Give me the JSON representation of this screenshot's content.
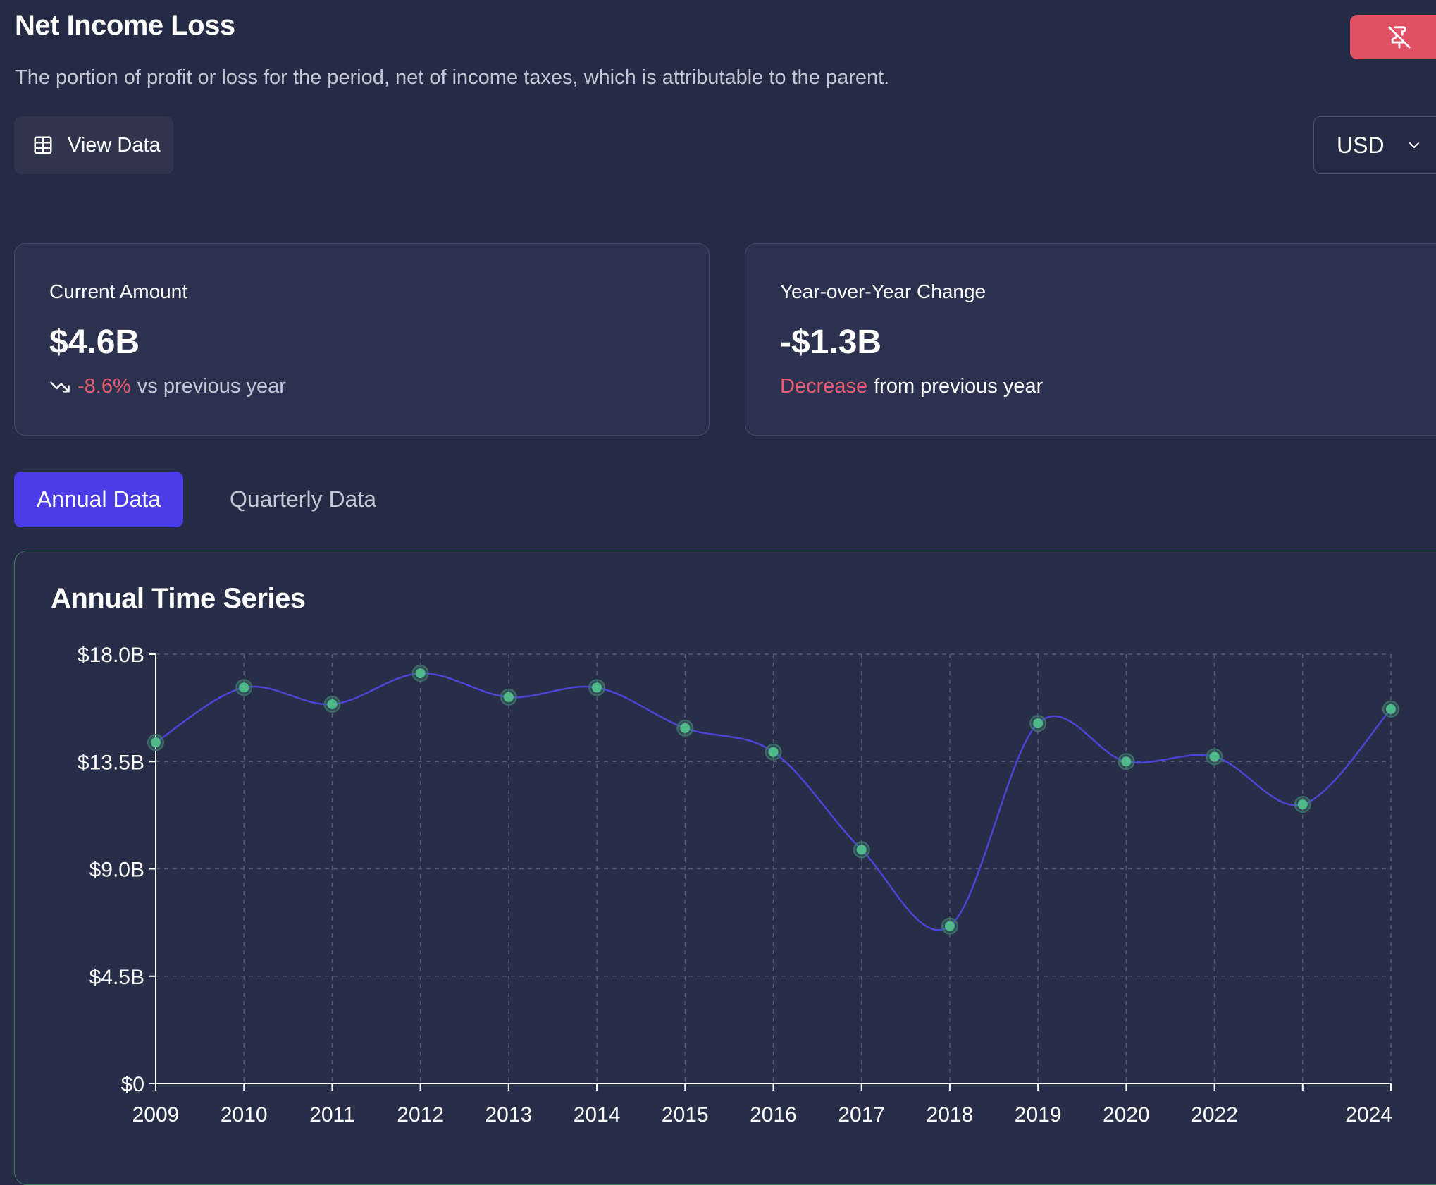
{
  "header": {
    "title": "Net Income Loss",
    "subtitle": "The portion of profit or loss for the period, net of income taxes, which is attributable to the parent."
  },
  "toolbar": {
    "view_data_label": "View Data",
    "currency": "USD",
    "unpin_icon": "pin-off-icon",
    "grid_icon": "table-grid-icon"
  },
  "cards": {
    "current": {
      "label": "Current Amount",
      "value": "$4.6B",
      "change_pct": "-8.6%",
      "change_suffix": "vs previous year"
    },
    "yoy": {
      "label": "Year-over-Year Change",
      "value": "-$1.3B",
      "direction": "Decrease",
      "suffix": "from previous year"
    }
  },
  "tabs": {
    "annual": "Annual Data",
    "quarterly": "Quarterly Data"
  },
  "colors": {
    "accent": "#4a3de8",
    "negative": "#e85a6d",
    "line": "#4b44d6",
    "point": "#4fb98a",
    "danger_button": "#e05165"
  },
  "chart_data": {
    "type": "line",
    "title": "Annual Time Series",
    "x": [
      "2009",
      "2010",
      "2011",
      "2012",
      "2013",
      "2014",
      "2015",
      "2016",
      "2017",
      "2018",
      "2019",
      "2020",
      "2022",
      "2023",
      "2024"
    ],
    "x_tick_labels": [
      "2009",
      "2010",
      "2011",
      "2012",
      "2013",
      "2014",
      "2015",
      "2016",
      "2017",
      "2018",
      "2019",
      "2020",
      "2022",
      "",
      "2024"
    ],
    "values": [
      14.3,
      16.6,
      15.9,
      17.2,
      16.2,
      16.6,
      14.9,
      13.9,
      9.8,
      6.6,
      15.1,
      13.5,
      13.7,
      11.7,
      15.7
    ],
    "unit": "B USD",
    "ylim": [
      0,
      18
    ],
    "y_ticks": [
      0,
      4.5,
      9,
      13.5,
      18
    ],
    "y_tick_labels": [
      "$0",
      "$4.5B",
      "$9.0B",
      "$13.5B",
      "$18.0B"
    ],
    "grid": true,
    "smooth": true
  }
}
